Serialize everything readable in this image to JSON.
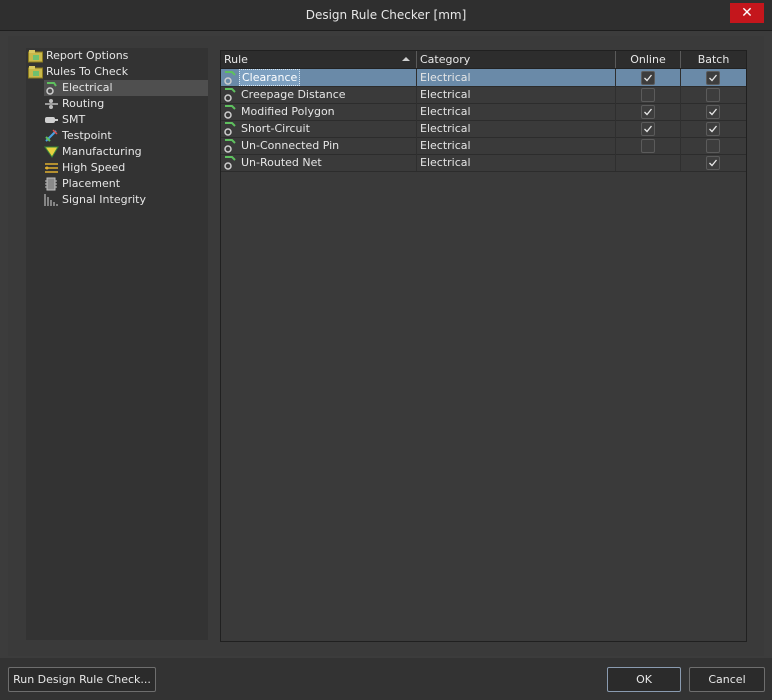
{
  "window": {
    "title": "Design Rule Checker [mm]"
  },
  "tree": {
    "items": [
      {
        "label": "Report Options",
        "icon": "folder-options-icon"
      },
      {
        "label": "Rules To Check",
        "icon": "folder-rules-icon"
      },
      {
        "label": "Electrical",
        "icon": "electrical-rule-icon",
        "selected": true
      },
      {
        "label": "Routing",
        "icon": "routing-rule-icon"
      },
      {
        "label": "SMT",
        "icon": "smt-rule-icon"
      },
      {
        "label": "Testpoint",
        "icon": "testpoint-rule-icon"
      },
      {
        "label": "Manufacturing",
        "icon": "manufacturing-rule-icon"
      },
      {
        "label": "High Speed",
        "icon": "high-speed-rule-icon"
      },
      {
        "label": "Placement",
        "icon": "placement-rule-icon"
      },
      {
        "label": "Signal Integrity",
        "icon": "signal-integrity-rule-icon"
      }
    ]
  },
  "grid": {
    "headers": {
      "rule": "Rule",
      "category": "Category",
      "online": "Online",
      "batch": "Batch"
    },
    "rows": [
      {
        "rule": "Clearance",
        "category": "Electrical",
        "online": true,
        "batch": true,
        "selected": true
      },
      {
        "rule": "Creepage Distance",
        "category": "Electrical",
        "online": false,
        "batch": false
      },
      {
        "rule": "Modified Polygon",
        "category": "Electrical",
        "online": true,
        "batch": true
      },
      {
        "rule": "Short-Circuit",
        "category": "Electrical",
        "online": true,
        "batch": true
      },
      {
        "rule": "Un-Connected Pin",
        "category": "Electrical",
        "online": false,
        "batch": false
      },
      {
        "rule": "Un-Routed Net",
        "category": "Electrical",
        "online": null,
        "batch": true
      }
    ]
  },
  "footer": {
    "run_label": "Run Design Rule Check...",
    "ok_label": "OK",
    "cancel_label": "Cancel"
  },
  "colors": {
    "selection": "#6a8aa8",
    "close": "#c4161c",
    "background": "#3c3c3c"
  }
}
